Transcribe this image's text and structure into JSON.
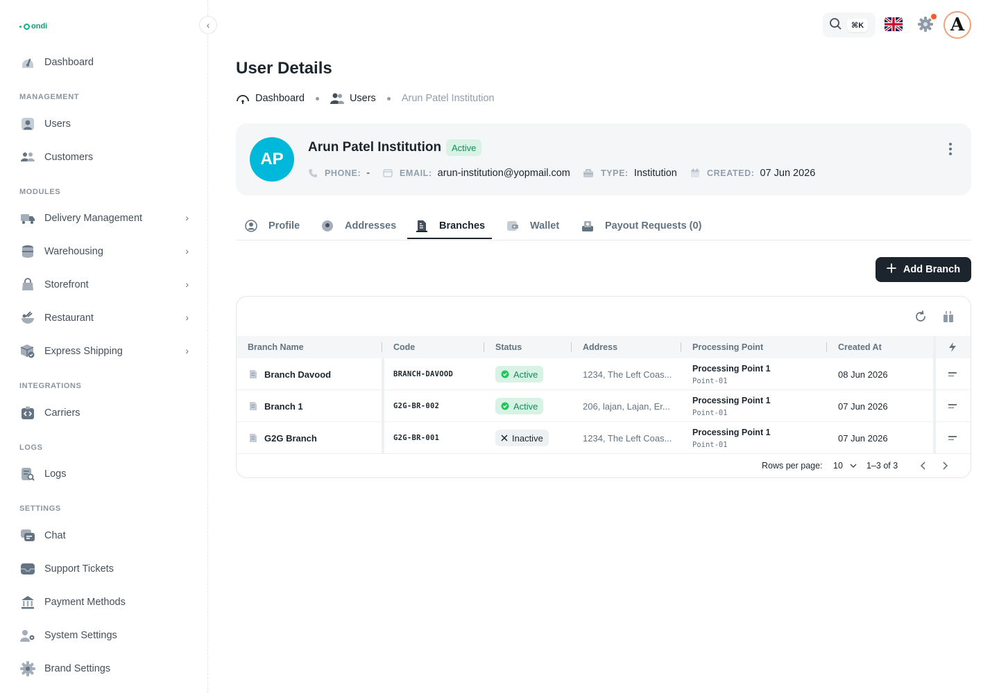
{
  "brand": {
    "logo_text": "ondi"
  },
  "sidebar": {
    "dashboard": "Dashboard",
    "sections": {
      "management": "MANAGEMENT",
      "modules": "MODULES",
      "integrations": "INTEGRATIONS",
      "logs": "LOGS",
      "settings": "SETTINGS"
    },
    "items": {
      "users": "Users",
      "customers": "Customers",
      "delivery": "Delivery Management",
      "warehousing": "Warehousing",
      "storefront": "Storefront",
      "restaurant": "Restaurant",
      "express": "Express Shipping",
      "carriers": "Carriers",
      "logs": "Logs",
      "chat": "Chat",
      "support": "Support Tickets",
      "payment": "Payment Methods",
      "system": "System Settings",
      "brand": "Brand Settings"
    }
  },
  "topbar": {
    "shortcut": "⌘K",
    "avatar_letter": "A",
    "notification_color": "#ff5630"
  },
  "page": {
    "title": "User Details",
    "breadcrumb": [
      "Dashboard",
      "Users",
      "Arun Patel Institution"
    ]
  },
  "user": {
    "initials": "AP",
    "name": "Arun Patel Institution",
    "status": "Active",
    "phone_label": "PHONE:",
    "phone": "-",
    "email_label": "EMAIL:",
    "email": "arun-institution@yopmail.com",
    "type_label": "TYPE:",
    "type": "Institution",
    "created_label": "CREATED:",
    "created": "07 Jun 2026",
    "avatar_color": "#00b8d9"
  },
  "tabs": [
    "Profile",
    "Addresses",
    "Branches",
    "Wallet",
    "Payout Requests (0)"
  ],
  "active_tab": "Branches",
  "actions": {
    "add_branch": "Add Branch"
  },
  "table": {
    "columns": [
      "Branch Name",
      "Code",
      "Status",
      "Address",
      "Processing Point",
      "Created At"
    ],
    "rows": [
      {
        "name": "Branch Davood",
        "code": "BRANCH-DAVOOD",
        "status": "Active",
        "address": "1234, The Left Coas...",
        "pp_name": "Processing Point 1",
        "pp_code": "Point-01",
        "created": "08 Jun 2026"
      },
      {
        "name": "Branch 1",
        "code": "G2G-BR-002",
        "status": "Active",
        "address": "206, lajan, Lajan, Er...",
        "pp_name": "Processing Point 1",
        "pp_code": "Point-01",
        "created": "07 Jun 2026"
      },
      {
        "name": "G2G Branch",
        "code": "G2G-BR-001",
        "status": "Inactive",
        "address": "1234, The Left Coas...",
        "pp_name": "Processing Point 1",
        "pp_code": "Point-01",
        "created": "07 Jun 2026"
      }
    ],
    "footer": {
      "rows_per_page_label": "Rows per page:",
      "rows_per_page": "10",
      "range": "1–3 of 3"
    }
  }
}
